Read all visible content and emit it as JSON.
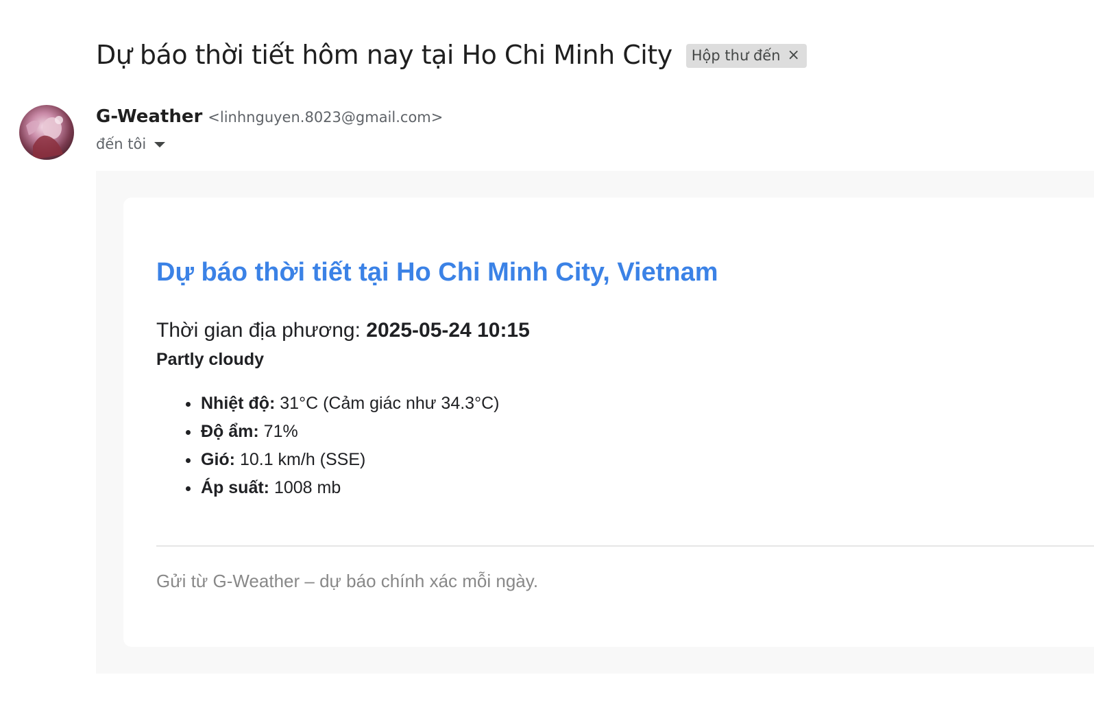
{
  "email": {
    "subject": "Dự báo thời tiết hôm nay tại Ho Chi Minh City",
    "label_chip": {
      "text": "Hộp thư đến",
      "remove_icon": "close-icon"
    },
    "sender": {
      "name": "G-Weather",
      "email": "<linhnguyen.8023@gmail.com>",
      "avatar_icon": "avatar-image"
    },
    "recipient_text": "đến tôi"
  },
  "weather": {
    "title": "Dự báo thời tiết tại Ho Chi Minh City, Vietnam",
    "local_time_label": "Thời gian địa phương: ",
    "local_time_value": "2025-05-24 10:15",
    "condition": "Partly cloudy",
    "stats": [
      {
        "label": "Nhiệt độ:",
        "value": " 31°C (Cảm giác như 34.3°C)"
      },
      {
        "label": "Độ ẩm:",
        "value": " 71%"
      },
      {
        "label": "Gió:",
        "value": " 10.1 km/h (SSE)"
      },
      {
        "label": "Áp suất:",
        "value": " 1008 mb"
      }
    ],
    "footer": "Gửi từ G-Weather – dự báo chính xác mỗi ngày."
  },
  "colors": {
    "title_blue": "#3b82e6",
    "chip_bg": "#dddddd",
    "body_bg": "#f8f8f8"
  }
}
